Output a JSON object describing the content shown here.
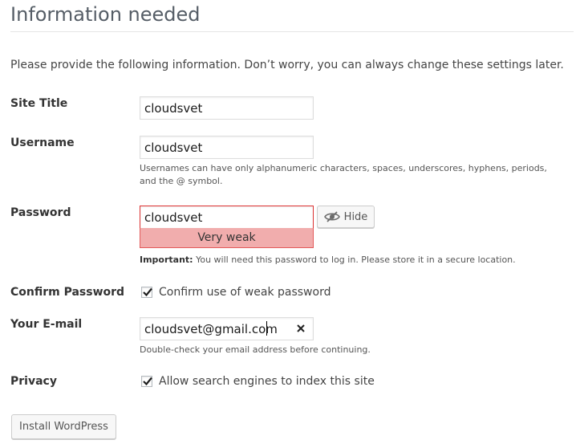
{
  "page": {
    "title": "Information needed",
    "intro": "Please provide the following information. Don’t worry, you can always change these settings later."
  },
  "form": {
    "site_title": {
      "label": "Site Title",
      "value": "cloudsvet"
    },
    "username": {
      "label": "Username",
      "value": "cloudsvet",
      "description": "Usernames can have only alphanumeric characters, spaces, underscores, hyphens, periods, and the @ symbol."
    },
    "password": {
      "label": "Password",
      "value": "cloudsvet",
      "strength": "Very weak",
      "hide_label": "Hide",
      "note_strong": "Important:",
      "note_text": " You will need this password to log in. Please store it in a secure location."
    },
    "confirm_password": {
      "label": "Confirm Password",
      "checkbox_label": "Confirm use of weak password",
      "checked": true
    },
    "email": {
      "label": "Your E-mail",
      "value": "cloudsvet@gmail.com",
      "description": "Double-check your email address before continuing."
    },
    "privacy": {
      "label": "Privacy",
      "checkbox_label": "Allow search engines to index this site",
      "checked": true
    },
    "submit_label": "Install WordPress"
  },
  "colors": {
    "strength_bg": "#f1adad",
    "strength_border": "#e35b5b",
    "error_border": "#dc3232"
  },
  "icons": {
    "hide": "eye-slash-icon",
    "clear": "close-icon",
    "check": "checkmark-icon"
  }
}
